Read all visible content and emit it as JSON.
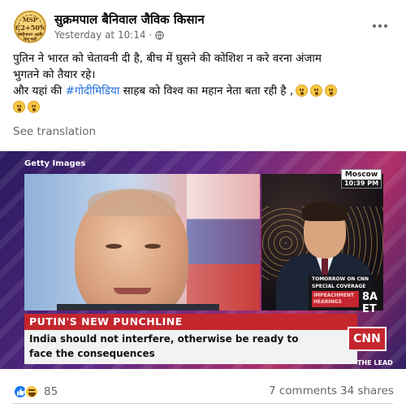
{
  "post": {
    "avatar_text": [
      "MSP",
      "C2+50%",
      "स्वामीनाथन आयोग लागू करो"
    ],
    "author": "सुक्रमपाल बैनिवाल जैविक किसान",
    "timestamp": "Yesterday at 10:14",
    "separator": "·",
    "privacy_icon": "globe-icon",
    "more_icon": "more-horizontal-icon",
    "text_lines": [
      "पुतिन ने भारत को चेतावनी दी है, बीच में घुसने की कोशिश न करे वरना अंजाम",
      "भुगतने को तैयार रहे।"
    ],
    "line3_prefix": "और यहां की ",
    "hashtag": "#गोदीमिडिया",
    "line3_suffix": " साहब को विश्व का महान नेता बता रही है ,",
    "emoji_icon": "surprised-face-emoji",
    "see_translation": "See translation"
  },
  "image": {
    "watermark": "Getty Images",
    "location": "Moscow",
    "time": "10:39 PM",
    "promo_line1": "TOMORROW ON CNN",
    "promo_line2": "SPECIAL COVERAGE",
    "promo_line3": "IMPEACHMENT HEARINGS",
    "promo_time": "8A ET",
    "headline": "PUTIN'S NEW PUNCHLINE",
    "caption_line1": "India should not interfere, otherwise be ready to",
    "caption_line2": "face the consequences",
    "network_logo": "CNN",
    "bottom_label": "THE LEAD"
  },
  "footer": {
    "reaction_icons": [
      "like-reaction-icon",
      "haha-reaction-icon"
    ],
    "reaction_count": "85",
    "comments": "7 comments",
    "shares": "34 shares"
  },
  "colors": {
    "text": "#050505",
    "secondary": "#65676b",
    "hashtag": "#216fdb",
    "like_blue": "#1877f2",
    "cnn_red": "#c4262e"
  }
}
